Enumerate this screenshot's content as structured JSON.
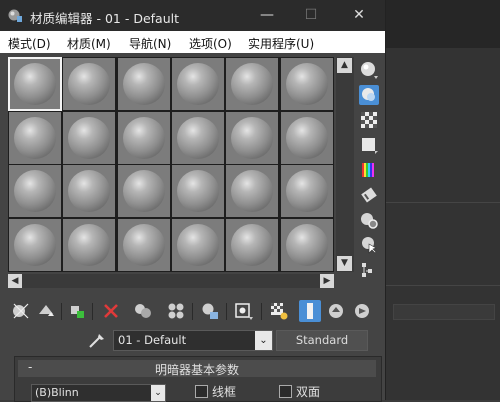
{
  "window": {
    "title": "材质编辑器 - 01 - Default"
  },
  "title_buttons": {
    "minimize": "—",
    "maximize": "☐",
    "close": "✕"
  },
  "menu": [
    {
      "label": "模式(D)"
    },
    {
      "label": "材质(M)"
    },
    {
      "label": "导航(N)"
    },
    {
      "label": "选项(O)"
    },
    {
      "label": "实用程序(U)"
    }
  ],
  "sample_slots": {
    "rows": 4,
    "columns": 6,
    "active_slot": 1
  },
  "scroll": {
    "up": "▲",
    "down": "▼",
    "left": "◀",
    "right": "▶"
  },
  "material": {
    "name": "01 - Default",
    "type": "Standard",
    "dropdown_arrow": "⌄"
  },
  "shader_rollout": {
    "collapse_symbol": "-",
    "title": "明暗器基本参数",
    "shader": "(B)Blinn",
    "options": [
      {
        "label": "线框",
        "checked": false
      },
      {
        "label": "双面",
        "checked": false
      }
    ]
  },
  "colors": {
    "accent": "#4a8fd6",
    "panel": "#444444",
    "titlebar": "#2b2b2b",
    "menubar": "#ffffff"
  }
}
